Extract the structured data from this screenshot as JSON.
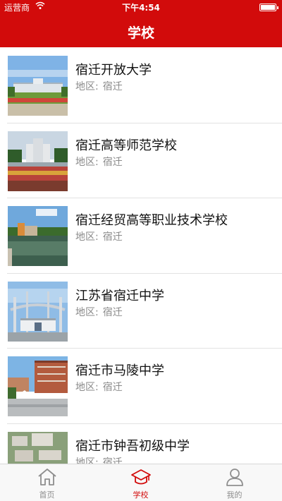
{
  "status_bar": {
    "carrier": "运营商",
    "time": "下午4:54"
  },
  "nav": {
    "title": "学校"
  },
  "schools": [
    {
      "name": "宿迁开放大学",
      "region_label": "地区:",
      "region": "宿迁"
    },
    {
      "name": "宿迁高等师范学校",
      "region_label": "地区:",
      "region": "宿迁"
    },
    {
      "name": "宿迁经贸高等职业技术学校",
      "region_label": "地区:",
      "region": "宿迁"
    },
    {
      "name": "江苏省宿迁中学",
      "region_label": "地区:",
      "region": "宿迁"
    },
    {
      "name": "宿迁市马陵中学",
      "region_label": "地区:",
      "region": "宿迁"
    },
    {
      "name": "宿迁市钟吾初级中学",
      "region_label": "地区:",
      "region": "宿迁"
    }
  ],
  "tabs": [
    {
      "label": "首页",
      "icon": "home-icon",
      "active": false
    },
    {
      "label": "学校",
      "icon": "graduation-cap-icon",
      "active": true
    },
    {
      "label": "我的",
      "icon": "user-icon",
      "active": false
    }
  ],
  "colors": {
    "brand": "#d20b0b",
    "tab_inactive": "#8e8e8e",
    "divider": "#e2e2e2"
  }
}
